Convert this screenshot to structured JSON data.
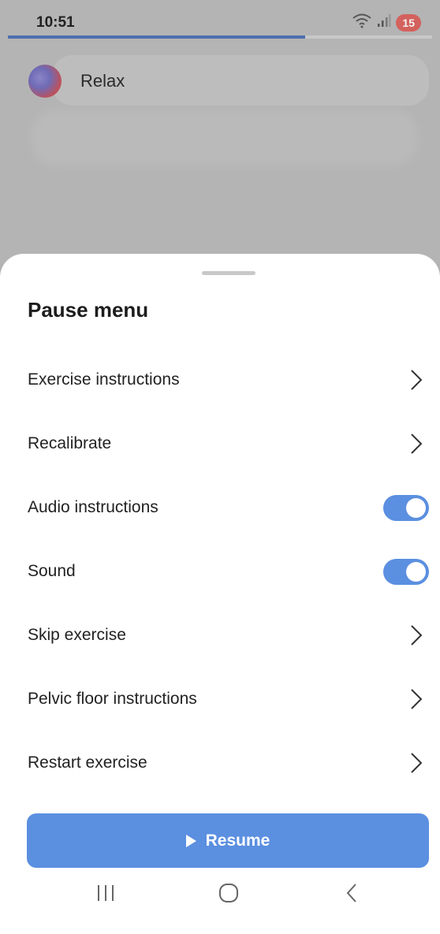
{
  "status_bar": {
    "time": "10:51",
    "battery": "15"
  },
  "exercise": {
    "title": "Relax",
    "progress": 0.7
  },
  "pause_menu": {
    "title": "Pause menu",
    "items": [
      {
        "label": "Exercise instructions",
        "control": "chevron"
      },
      {
        "label": "Recalibrate",
        "control": "chevron"
      },
      {
        "label": "Audio instructions",
        "control": "toggle",
        "on": true
      },
      {
        "label": "Sound",
        "control": "toggle",
        "on": true
      },
      {
        "label": "Skip exercise",
        "control": "chevron"
      },
      {
        "label": "Pelvic floor instructions",
        "control": "chevron"
      },
      {
        "label": "Restart exercise",
        "control": "chevron"
      }
    ],
    "resume_label": "Resume"
  },
  "colors": {
    "accent": "#5b8fe0",
    "backdrop": "#b4b4b4",
    "sheet": "#ffffff"
  }
}
